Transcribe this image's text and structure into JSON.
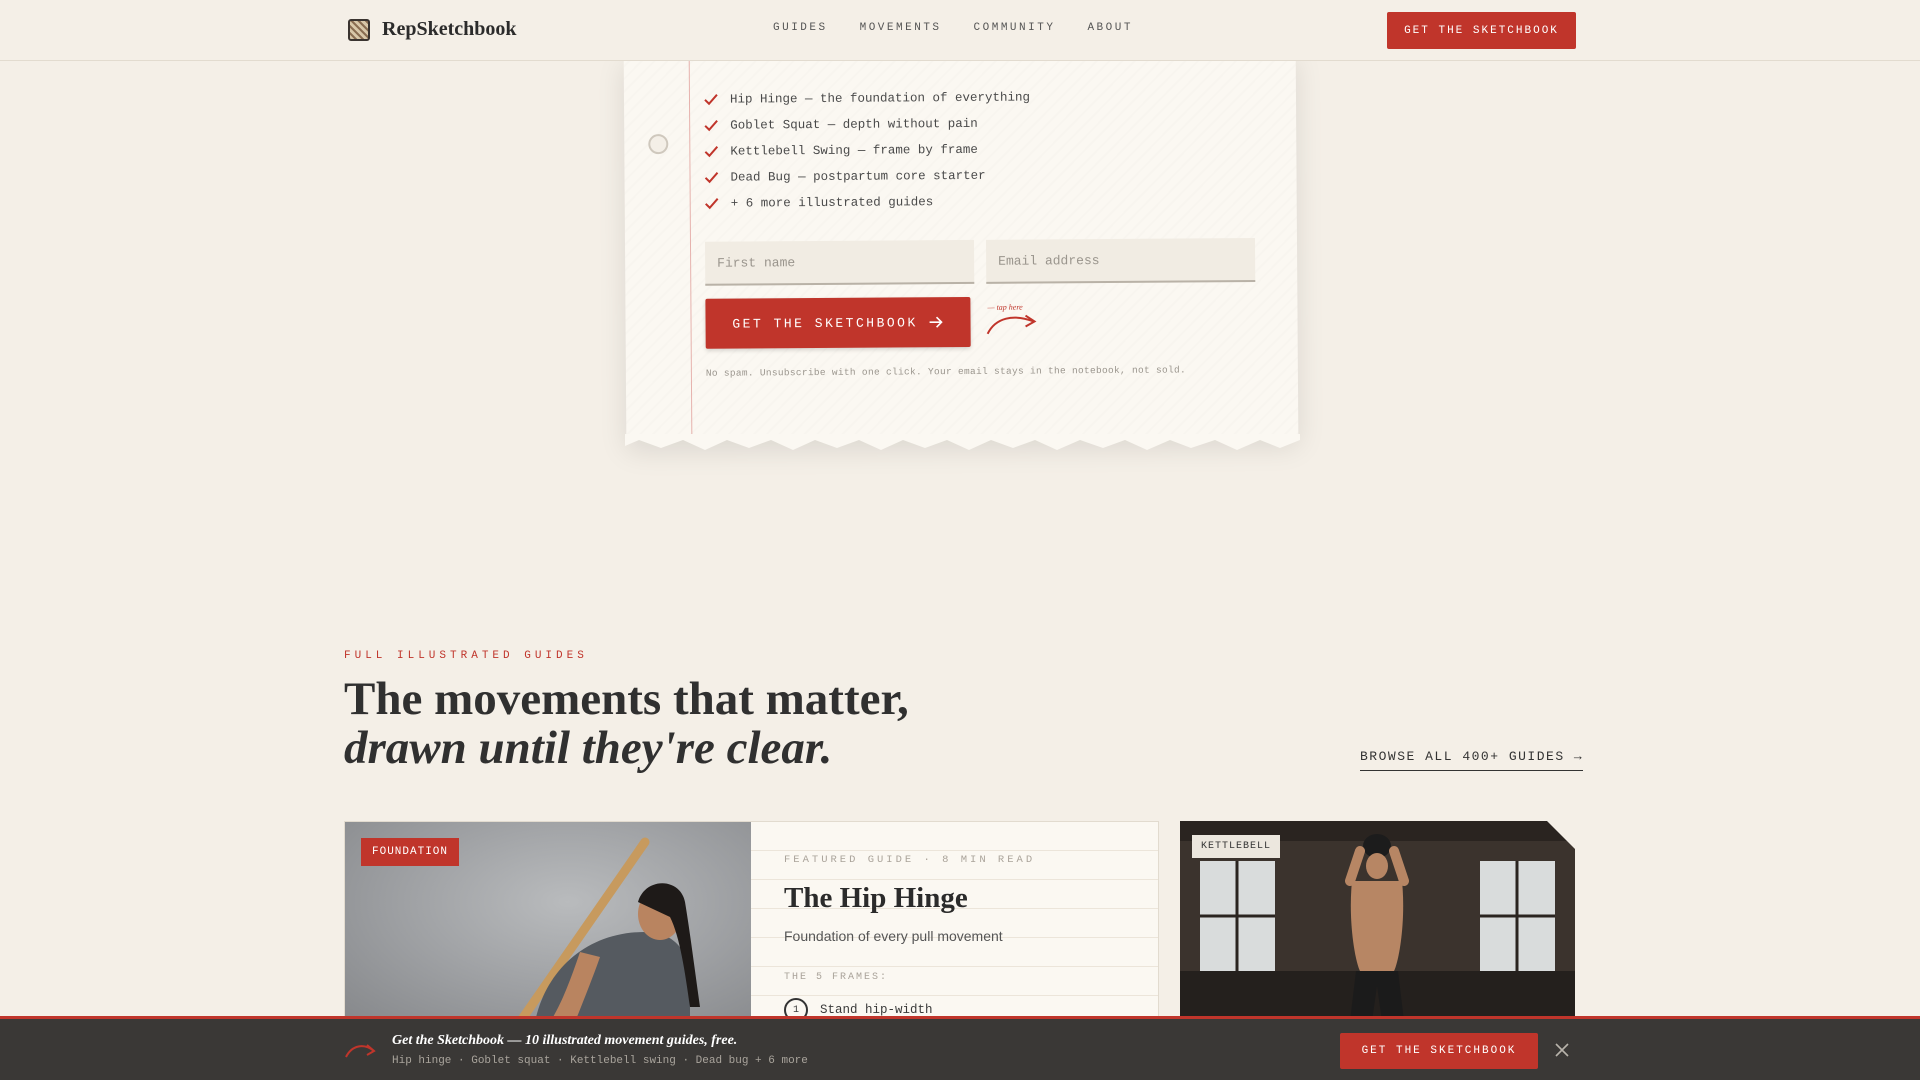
{
  "nav": {
    "brand": "RepSketchbook",
    "links": [
      "GUIDES",
      "MOVEMENTS",
      "COMMUNITY",
      "ABOUT"
    ],
    "cta": "GET THE SKETCHBOOK"
  },
  "signup": {
    "checklist": [
      "Hip Hinge — the foundation of everything",
      "Goblet Squat — depth without pain",
      "Kettlebell Swing — frame by frame",
      "Dead Bug — postpartum core starter",
      "+ 6 more illustrated guides"
    ],
    "first_name_placeholder": "First name",
    "email_placeholder": "Email address",
    "cta": "GET THE SKETCHBOOK",
    "tap_note": "— tap here",
    "fine_print": "No spam. Unsubscribe with one click. Your email stays in the notebook, not sold."
  },
  "guides": {
    "eyebrow": "FULL ILLUSTRATED GUIDES",
    "headline": "The movements that matter,",
    "headline_italic": "drawn until they're clear.",
    "browse": "BROWSE ALL 400+ GUIDES →"
  },
  "featured": {
    "tag": "FOUNDATION",
    "meta": "FEATURED GUIDE · 8 MIN READ",
    "title": "The Hip Hinge",
    "subtitle": "Foundation of every pull movement",
    "frames_label": "THE 5 FRAMES:",
    "steps": [
      {
        "num": "1",
        "label": "Stand hip-width"
      }
    ]
  },
  "kettlebell": {
    "tag": "KETTLEBELL"
  },
  "bottom_bar": {
    "title": "Get the Sketchbook — 10 illustrated movement guides, free.",
    "subtitle": "Hip hinge · Goblet squat · Kettlebell swing · Dead bug + 6 more",
    "cta": "GET THE SKETCHBOOK"
  },
  "colors": {
    "accent": "#c0352b",
    "background": "#f4efe7",
    "bar": "#3a3836"
  }
}
